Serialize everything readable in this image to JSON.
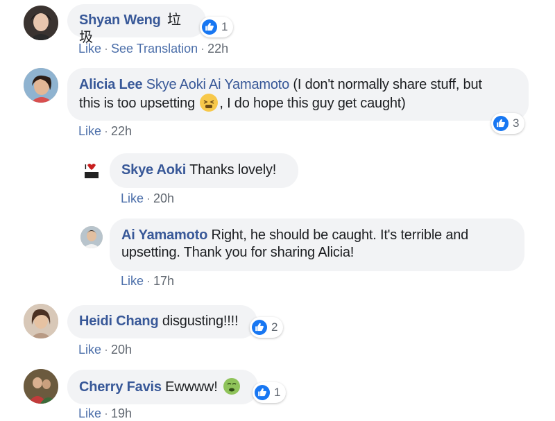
{
  "comments": [
    {
      "name": "Shyan Weng",
      "text": "垃圾",
      "reactions": "1",
      "actions": [
        "Like",
        "See Translation"
      ],
      "time": "22h"
    },
    {
      "name": "Alicia Lee",
      "mentions": "Skye Aoki Ai Yamamoto",
      "text1": "(I don't normally share stuff, but",
      "text2a": "this is too upsetting",
      "text2b": ", I do hope this guy get caught)",
      "reactions": "3",
      "actions": [
        "Like"
      ],
      "time": "22h"
    },
    {
      "name": "Skye Aoki",
      "text": "Thanks lovely!",
      "actions": [
        "Like"
      ],
      "time": "20h"
    },
    {
      "name": "Ai Yamamoto",
      "text1": "Right, he should be caught. It's terrible and",
      "text2": "upsetting. Thank you for sharing Alicia!",
      "actions": [
        "Like"
      ],
      "time": "17h"
    },
    {
      "name": "Heidi Chang",
      "text": "disgusting!!!!",
      "reactions": "2",
      "actions": [
        "Like"
      ],
      "time": "20h"
    },
    {
      "name": "Cherry Favis",
      "text": "Ewwww!",
      "reactions": "1",
      "actions": [
        "Like"
      ],
      "time": "19h"
    }
  ],
  "icons": {
    "reaction": "like-thumb-icon",
    "emoji_tired": "tired-face-icon",
    "emoji_nauseated": "nauseated-face-icon"
  },
  "colors": {
    "name": "#385898",
    "bubble": "#f2f3f5",
    "like_blue": "#1877f2",
    "meta": "#606770"
  }
}
